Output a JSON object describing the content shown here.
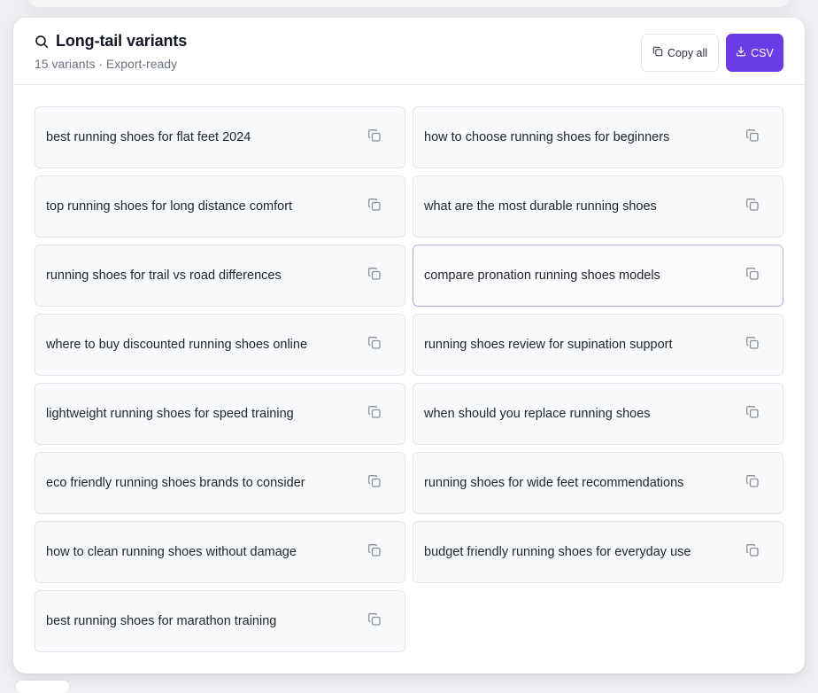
{
  "header": {
    "icon": "search-icon",
    "title": "Long-tail variants",
    "subtitle": "15 variants · Export-ready"
  },
  "actions": {
    "copy_all_label": "Copy all",
    "copy_all_icon": "copy-icon",
    "csv_label": "CSV",
    "csv_icon": "download-icon"
  },
  "colors": {
    "accent": "#6a3ce6",
    "selected_border": "#b9aee8"
  },
  "variants": [
    "best running shoes for flat feet 2024",
    "how to choose running shoes for beginners",
    "top running shoes for long distance comfort",
    "what are the most durable running shoes",
    "running shoes for trail vs road differences",
    "compare pronation running shoes models",
    "where to buy discounted running shoes online",
    "running shoes review for supination support",
    "lightweight running shoes for speed training",
    "when should you replace running shoes",
    "eco friendly running shoes brands to consider",
    "running shoes for wide feet recommendations",
    "how to clean running shoes without damage",
    "budget friendly running shoes for everyday use",
    "best running shoes for marathon training"
  ]
}
